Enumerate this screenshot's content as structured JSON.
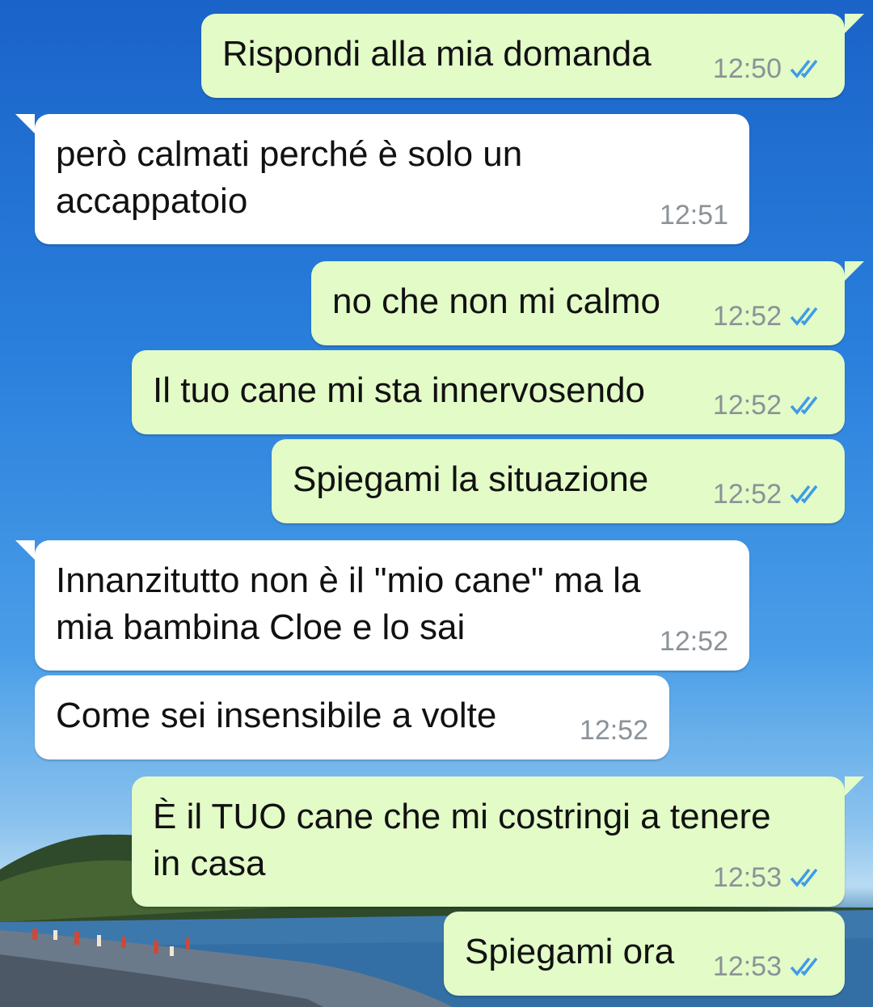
{
  "colors": {
    "outgoing_bubble": "#e2fbc7",
    "incoming_bubble": "#ffffff",
    "timestamp": "#8b9298",
    "read_ticks": "#3f9be8"
  },
  "messages": [
    {
      "direction": "out",
      "text": "Rispondi alla mia domanda",
      "time": "12:50",
      "status_icon": "double-check-read-icon"
    },
    {
      "direction": "in",
      "text": "però calmati perché è solo un\naccappatoio",
      "time": "12:51"
    },
    {
      "direction": "out",
      "text": "no che non mi calmo",
      "time": "12:52",
      "status_icon": "double-check-read-icon"
    },
    {
      "direction": "out",
      "text": "Il tuo cane mi sta innervosendo",
      "time": "12:52",
      "status_icon": "double-check-read-icon"
    },
    {
      "direction": "out",
      "text": "Spiegami la situazione",
      "time": "12:52",
      "status_icon": "double-check-read-icon"
    },
    {
      "direction": "in",
      "text": "Innanzitutto non è il \"mio cane\" ma la\nmia bambina Cloe e lo sai",
      "time": "12:52"
    },
    {
      "direction": "in",
      "text": "Come sei insensibile a volte",
      "time": "12:52"
    },
    {
      "direction": "out",
      "text": "È il TUO cane che mi costringi a tenere\nin casa",
      "time": "12:53",
      "status_icon": "double-check-read-icon"
    },
    {
      "direction": "out",
      "text": "Spiegami ora",
      "time": "12:53",
      "status_icon": "double-check-read-icon"
    }
  ]
}
